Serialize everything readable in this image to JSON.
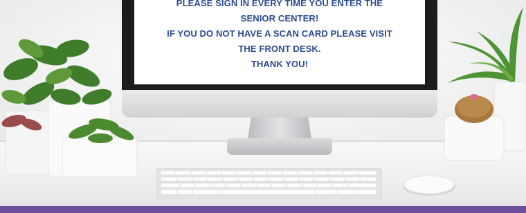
{
  "screen_message": {
    "line1": "PLEASE SIGN IN EVERY TIME YOU ENTER THE",
    "line2": "SENIOR CENTER!",
    "line3": "IF YOU DO NOT HAVE A SCAN CARD PLEASE VISIT",
    "line4": "THE FRONT DESK.",
    "line5": "THANK YOU!"
  },
  "colors": {
    "text": "#2b4a8f",
    "bottom_band": "#6b4f9a",
    "monitor_bezel": "#1c1c1e"
  }
}
